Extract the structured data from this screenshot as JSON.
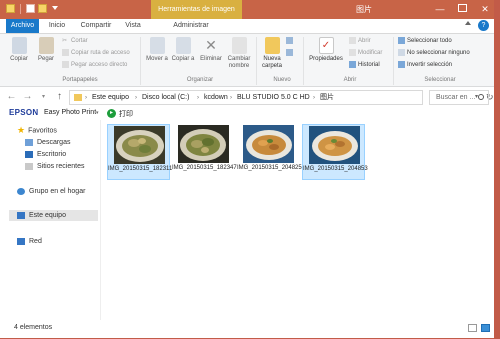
{
  "titlebar": {
    "context_tab": "Herramientas de imagen",
    "title": "图片",
    "min_glyph": "—",
    "close_glyph": "✕"
  },
  "tabs": {
    "file": "Archivo",
    "home": "Inicio",
    "share": "Compartir",
    "view": "Vista",
    "manage": "Administrar",
    "help_glyph": "?"
  },
  "ribbon": {
    "clipboard": {
      "copy": "Copiar",
      "paste": "Pegar",
      "cut": "Cortar",
      "copy_path": "Copiar ruta de acceso",
      "paste_shortcut": "Pegar acceso directo",
      "label": "Portapapeles"
    },
    "organize": {
      "move_to": "Mover a",
      "copy_to": "Copiar a",
      "delete": "Eliminar",
      "rename": "Cambiar nombre",
      "label": "Organizar"
    },
    "new": {
      "new_folder": "Nueva carpeta",
      "label": "Nuevo"
    },
    "open": {
      "properties": "Propiedades",
      "open": "Abrir",
      "edit": "Modificar",
      "history": "Historial",
      "label": "Abrir"
    },
    "select": {
      "select_all": "Seleccionar todo",
      "select_none": "No seleccionar ninguno",
      "invert": "Invertir selección",
      "label": "Seleccionar"
    }
  },
  "address": {
    "breadcrumb": [
      "Este equipo",
      "Disco local (C:)",
      "kcdown",
      "BLU STUDIO 5.0 C HD",
      "图片"
    ],
    "search_placeholder": "Buscar en ..."
  },
  "epson": {
    "logo": "EPSON",
    "app": "Easy Photo Print",
    "print": "打印"
  },
  "nav": {
    "favorites": "Favoritos",
    "downloads": "Descargas",
    "desktop": "Escritorio",
    "recent": "Sitios recientes",
    "homegroup": "Grupo en el hogar",
    "this_pc": "Este equipo",
    "network": "Red"
  },
  "files": [
    {
      "name": "IMG_20150315_182311",
      "selected": true
    },
    {
      "name": "IMG_20150315_182347",
      "selected": false
    },
    {
      "name": "IMG_20150315_204825",
      "selected": false
    },
    {
      "name": "IMG_20150315_204853",
      "selected": true
    }
  ],
  "status": {
    "count": "4 elementos"
  },
  "colors": {
    "titlebar": "#c86447",
    "context_tab": "#d9b040",
    "file_tab": "#1979ca",
    "selection": "#cce8ff"
  }
}
